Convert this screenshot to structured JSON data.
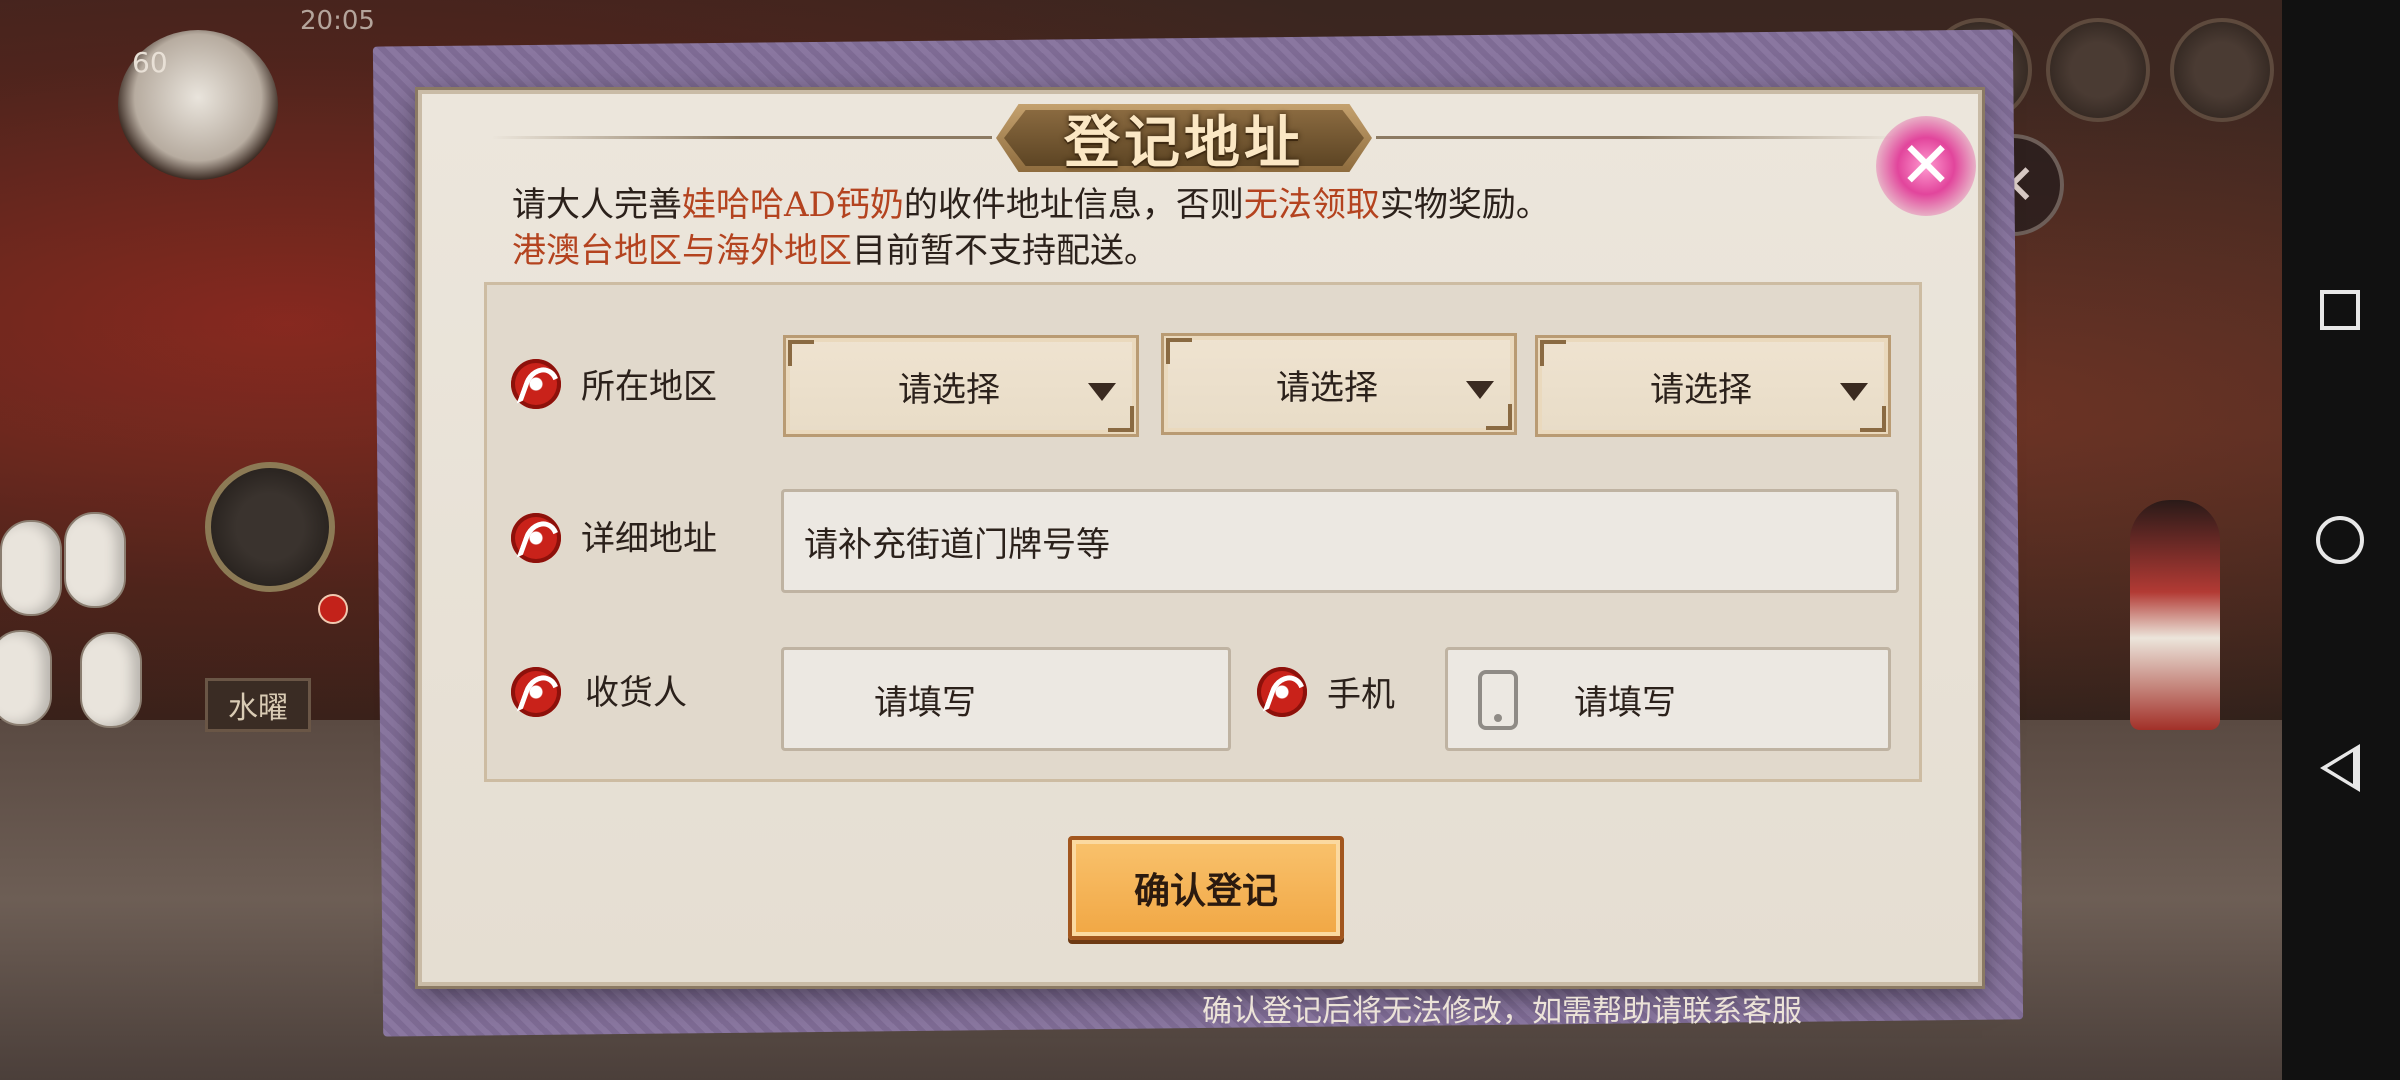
{
  "status_bar": {
    "time": "20:05"
  },
  "player": {
    "level": "60"
  },
  "scene": {
    "sign_label": "水曜"
  },
  "dialog": {
    "title": "登记地址",
    "close_symbol": "✕",
    "notice": {
      "line1_a": "请大人完善",
      "line1_product": "娃哈哈AD钙奶",
      "line1_b": "的收件地址信息，否则",
      "line1_warning": "无法领取",
      "line1_c": "实物奖励。",
      "line2_region": "港澳台地区与海外地区",
      "line2_b": "目前暂不支持配送。"
    },
    "fields": {
      "region_label": "所在地区",
      "region_selects": [
        "请选择",
        "请选择",
        "请选择"
      ],
      "address_label": "详细地址",
      "address_placeholder": "请补充街道门牌号等",
      "receiver_label": "收货人",
      "receiver_placeholder": "请填写",
      "phone_label": "手机",
      "phone_placeholder": "请填写"
    },
    "confirm_label": "确认登记",
    "footer_note": "确认登记后将无法修改，如需帮助请联系客服"
  },
  "colors": {
    "highlight": "#b4431f",
    "button": "#f1a744",
    "emblem": "#c9221a"
  },
  "icons": [
    "tomoe-icon",
    "phone-icon",
    "close-icon",
    "caret-down-icon"
  ]
}
